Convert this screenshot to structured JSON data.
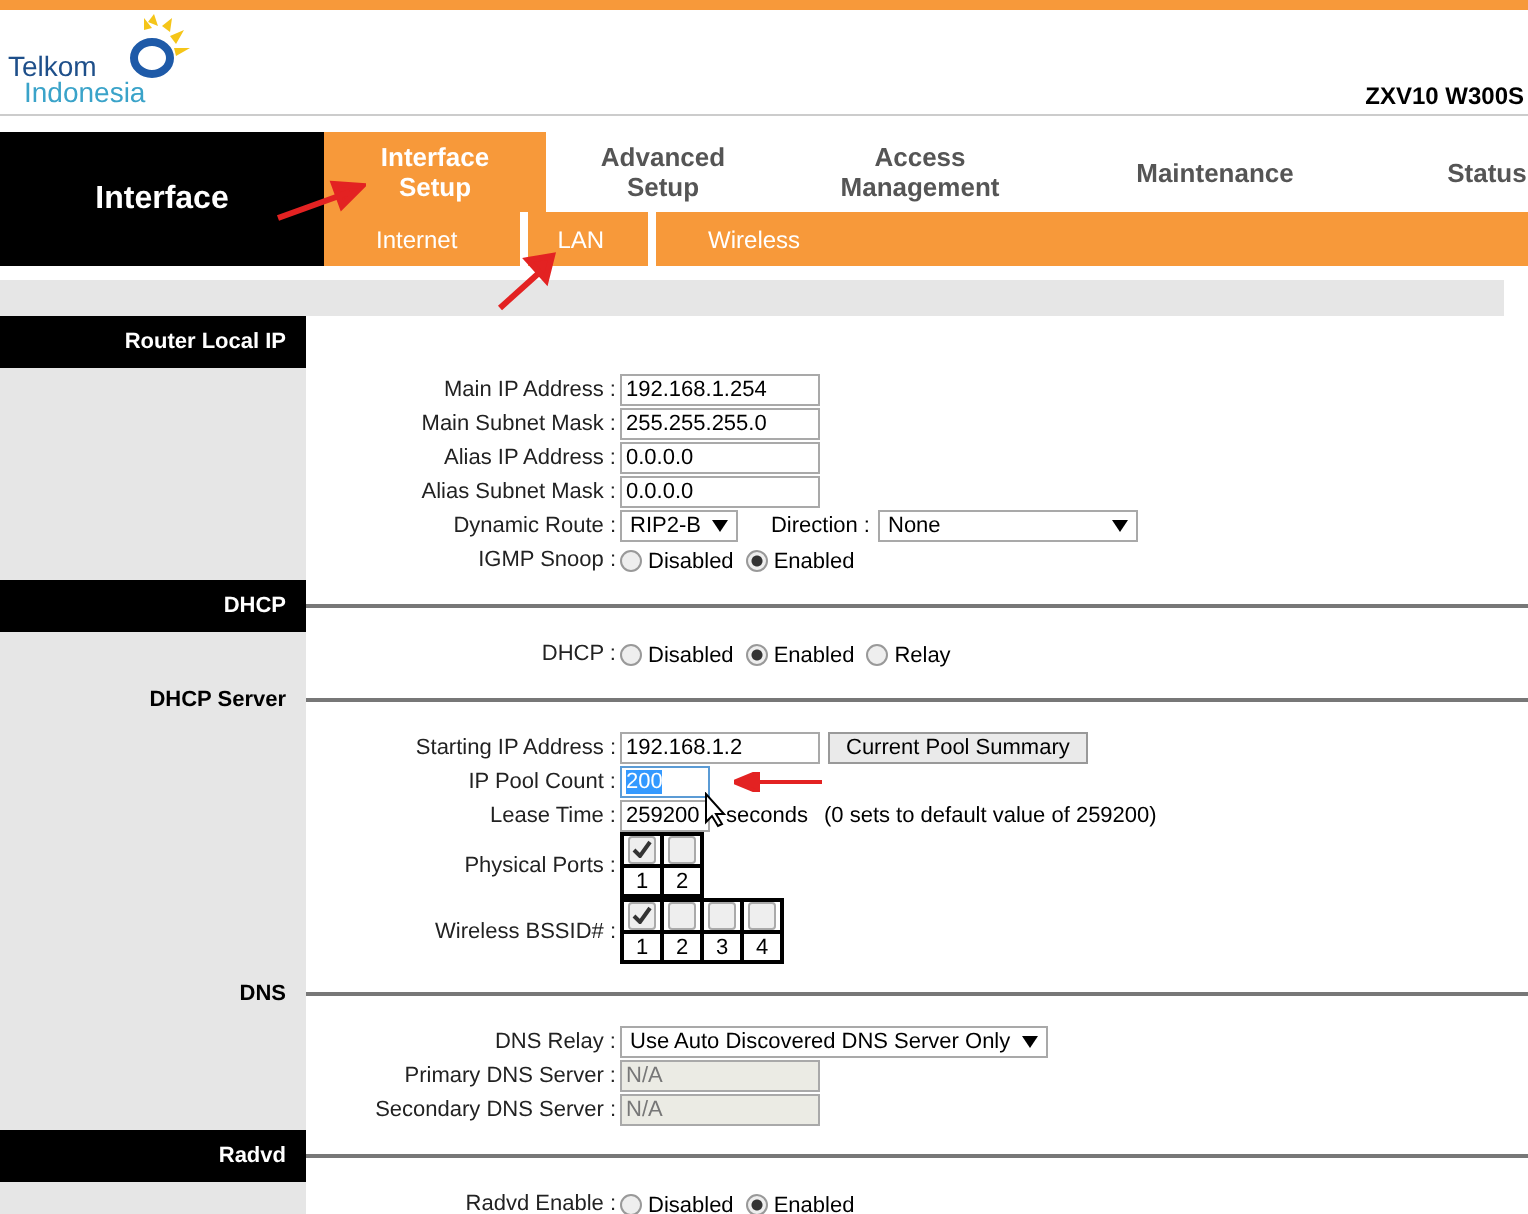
{
  "header": {
    "logo_line1": "Telkom",
    "logo_line2": "Indonesia",
    "model": "ZXV10 W300S"
  },
  "nav": {
    "title": "Interface",
    "tabs": [
      {
        "label": "Interface Setup",
        "selected": true
      },
      {
        "label": "Advanced Setup",
        "selected": false
      },
      {
        "label": "Access Management",
        "selected": false
      },
      {
        "label": "Maintenance",
        "selected": false
      },
      {
        "label": "Status",
        "selected": false
      }
    ],
    "subtabs": [
      {
        "label": "Internet",
        "selected": false
      },
      {
        "label": "LAN",
        "selected": true
      },
      {
        "label": "Wireless",
        "selected": false
      }
    ]
  },
  "sections": [
    {
      "title": "Router Local IP",
      "kind": "dark",
      "fields": [
        {
          "label": "Main IP Address :",
          "controls": [
            {
              "kind": "input",
              "value": "192.168.1.254",
              "highlighted": false,
              "disabled": false
            }
          ]
        },
        {
          "label": "Main Subnet Mask :",
          "controls": [
            {
              "kind": "input",
              "value": "255.255.255.0",
              "highlighted": false,
              "disabled": false
            }
          ]
        },
        {
          "label": "Alias IP Address :",
          "controls": [
            {
              "kind": "input",
              "value": "0.0.0.0",
              "highlighted": false,
              "disabled": false
            }
          ]
        },
        {
          "label": "Alias Subnet Mask :",
          "controls": [
            {
              "kind": "input",
              "value": "0.0.0.0",
              "highlighted": false,
              "disabled": false
            }
          ]
        },
        {
          "label": "Dynamic Route :",
          "controls": [
            {
              "kind": "select",
              "value": "RIP2-B"
            },
            {
              "kind": "label",
              "text": "Direction :"
            },
            {
              "kind": "wide_select",
              "value": "None"
            }
          ]
        },
        {
          "label": "IGMP Snoop :",
          "controls": [
            {
              "kind": "radio",
              "label": "Disabled",
              "selected": false
            },
            {
              "kind": "radio",
              "label": "Enabled",
              "selected": true
            }
          ]
        }
      ]
    },
    {
      "title": "DHCP",
      "kind": "dark",
      "fields": [
        {
          "label": "DHCP :",
          "controls": [
            {
              "kind": "radio",
              "label": "Disabled",
              "selected": false
            },
            {
              "kind": "radio",
              "label": "Enabled",
              "selected": true
            },
            {
              "kind": "radio",
              "label": "Relay",
              "selected": false
            }
          ]
        }
      ]
    },
    {
      "title": "DHCP Server",
      "kind": "light",
      "fields": [
        {
          "label": "Starting IP Address :",
          "controls": [
            {
              "kind": "input",
              "value": "192.168.1.2",
              "highlighted": false,
              "disabled": false
            },
            {
              "kind": "button",
              "label": "Current Pool Summary"
            }
          ]
        },
        {
          "label": "IP Pool Count :",
          "controls": [
            {
              "kind": "number_input",
              "value": "200",
              "highlighted": true,
              "disabled": false
            },
            {
              "kind": "arrow"
            }
          ]
        },
        {
          "label": "Lease Time :",
          "controls": [
            {
              "kind": "number_input",
              "value": "259200",
              "highlighted": false,
              "disabled": false
            },
            {
              "kind": "note",
              "text": "seconds"
            },
            {
              "kind": "note",
              "text": "(0 sets to default value of 259200)"
            }
          ]
        },
        {
          "label": "Physical Ports :",
          "controls": [
            {
              "kind": "checkgrid",
              "items": [
                {
                  "label": "1",
                  "checked": true
                },
                {
                  "label": "2",
                  "checked": false
                }
              ]
            }
          ]
        },
        {
          "label": "Wireless BSSID# :",
          "controls": [
            {
              "kind": "checkgrid",
              "items": [
                {
                  "label": "1",
                  "checked": true
                },
                {
                  "label": "2",
                  "checked": false
                },
                {
                  "label": "3",
                  "checked": false
                },
                {
                  "label": "4",
                  "checked": false
                }
              ]
            }
          ]
        }
      ]
    },
    {
      "title": "DNS",
      "kind": "light",
      "fields": [
        {
          "label": "DNS Relay :",
          "controls": [
            {
              "kind": "wide_select",
              "value": "Use Auto Discovered DNS Server Only"
            }
          ]
        },
        {
          "label": "Primary DNS Server :",
          "controls": [
            {
              "kind": "input",
              "value": "N/A",
              "highlighted": false,
              "disabled": true
            }
          ]
        },
        {
          "label": "Secondary DNS Server :",
          "controls": [
            {
              "kind": "input",
              "value": "N/A",
              "highlighted": false,
              "disabled": true
            }
          ]
        }
      ]
    },
    {
      "title": "Radvd",
      "kind": "dark",
      "fields": [
        {
          "label": "Radvd Enable :",
          "controls": [
            {
              "kind": "radio",
              "label": "Disabled",
              "selected": false
            },
            {
              "kind": "radio",
              "label": "Enabled",
              "selected": true
            }
          ]
        }
      ]
    }
  ]
}
